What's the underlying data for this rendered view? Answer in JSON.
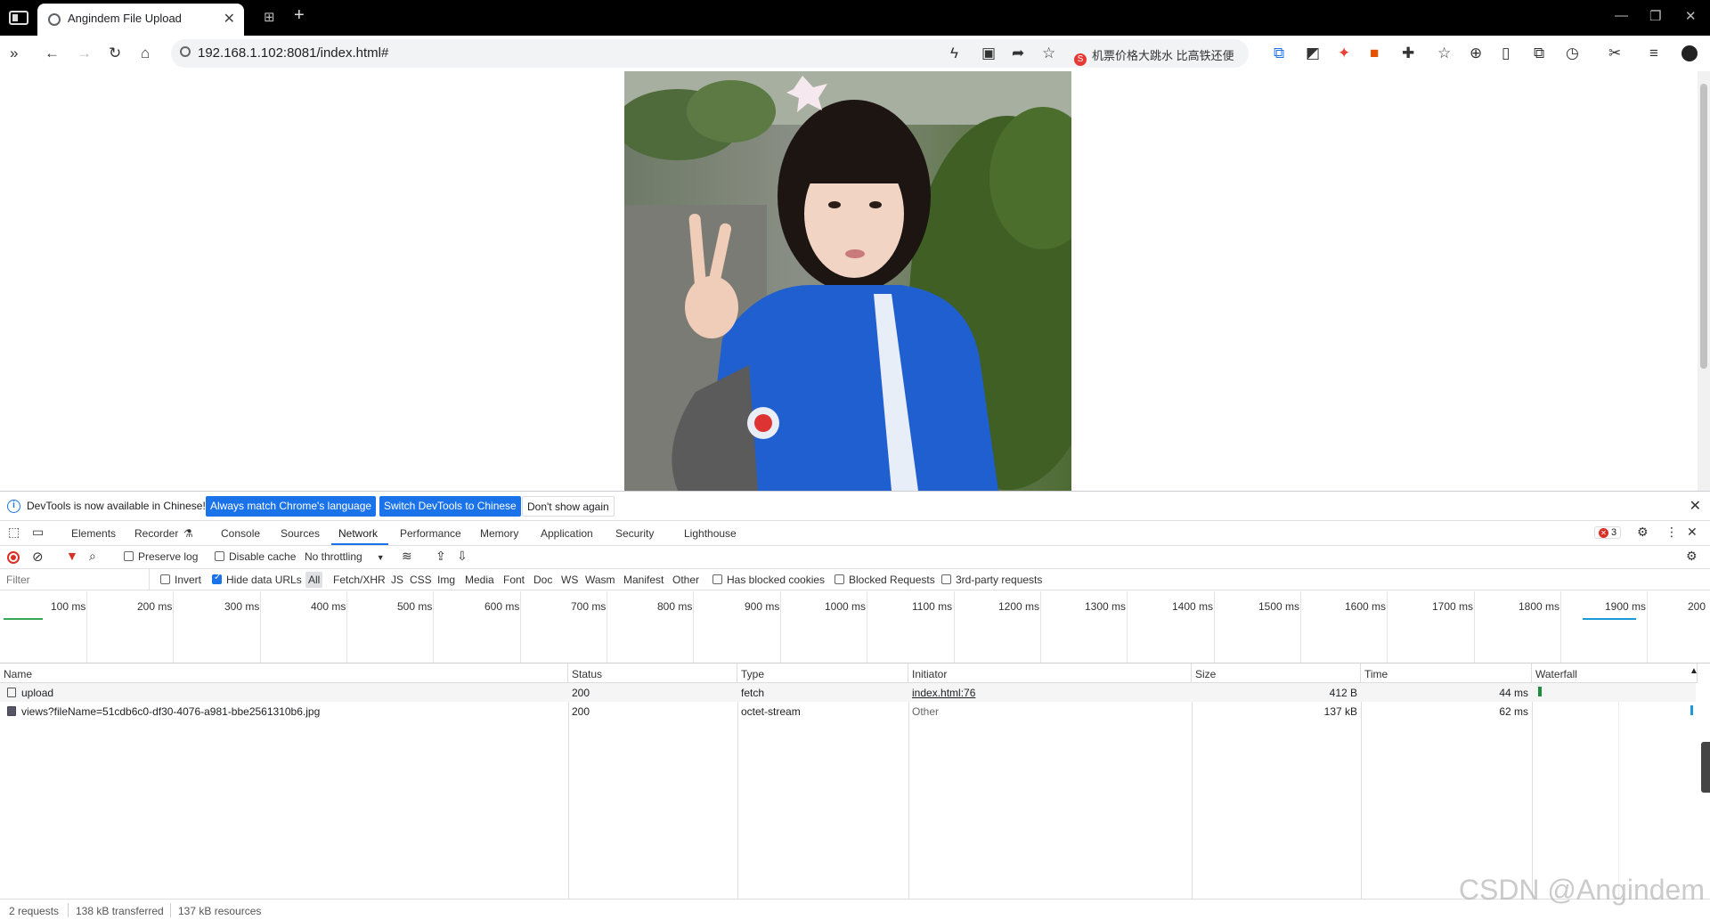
{
  "browser": {
    "tab_title": "Angindem File Upload",
    "url": "192.168.1.102:8081/index.html#",
    "hot_search": "机票价格大跳水 比高铁还便"
  },
  "infobar": {
    "message": "DevTools is now available in Chinese!",
    "btn_match": "Always match Chrome's language",
    "btn_switch": "Switch DevTools to Chinese",
    "btn_dismiss": "Don't show again"
  },
  "devtools_tabs": [
    "Elements",
    "Recorder",
    "Console",
    "Sources",
    "Network",
    "Performance",
    "Memory",
    "Application",
    "Security",
    "Lighthouse"
  ],
  "error_count": "3",
  "net_toolbar": {
    "preserve_log": "Preserve log",
    "disable_cache": "Disable cache",
    "throttling": "No throttling"
  },
  "filters": {
    "placeholder": "Filter",
    "invert": "Invert",
    "hide_data_urls": "Hide data URLs",
    "types": [
      "All",
      "Fetch/XHR",
      "JS",
      "CSS",
      "Img",
      "Media",
      "Font",
      "Doc",
      "WS",
      "Wasm",
      "Manifest",
      "Other"
    ],
    "has_blocked_cookies": "Has blocked cookies",
    "blocked_requests": "Blocked Requests",
    "third_party": "3rd-party requests"
  },
  "timeline_labels": [
    "100 ms",
    "200 ms",
    "300 ms",
    "400 ms",
    "500 ms",
    "600 ms",
    "700 ms",
    "800 ms",
    "900 ms",
    "1000 ms",
    "1100 ms",
    "1200 ms",
    "1300 ms",
    "1400 ms",
    "1500 ms",
    "1600 ms",
    "1700 ms",
    "1800 ms",
    "1900 ms",
    "200"
  ],
  "table": {
    "headers": [
      "Name",
      "Status",
      "Type",
      "Initiator",
      "Size",
      "Time",
      "Waterfall"
    ],
    "rows": [
      {
        "name": "upload",
        "status": "200",
        "type": "fetch",
        "initiator": "index.html:76",
        "size": "412 B",
        "time": "44 ms"
      },
      {
        "name": "views?fileName=51cdb6c0-df30-4076-a981-bbe2561310b6.jpg",
        "status": "200",
        "type": "octet-stream",
        "initiator": "Other",
        "size": "137 kB",
        "time": "62 ms"
      }
    ]
  },
  "status": {
    "requests": "2 requests",
    "transferred": "138 kB transferred",
    "resources": "137 kB resources"
  },
  "watermark": "CSDN @Angindem",
  "colors": {
    "accent": "#1a73e8",
    "jacket_blue": "#1f5fcf",
    "error_red": "#d93025"
  }
}
